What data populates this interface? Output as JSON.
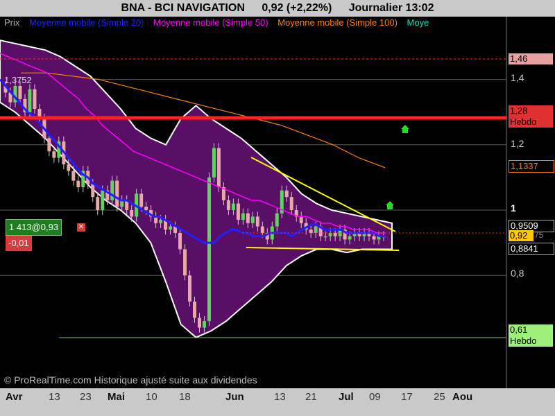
{
  "title": {
    "symbol": "BNA - BCI NAVIGATION",
    "quote": "0,92 (+2,22%)",
    "period": "Journalier  13:02"
  },
  "legend": {
    "price": "Prix",
    "ma20": "Moyenne mobile (Simple 20)",
    "ma50": "Moyenne mobile (Simple 50)",
    "ma100": "Moyenne mobile (Simple 100)",
    "ma_cut": "Moye",
    "colors": {
      "price": "#b0b0b0",
      "ma20": "#2020ff",
      "ma50": "#ff00ff",
      "ma100": "#ff8000",
      "ma_cut": "#00e0c0"
    }
  },
  "boxes": {
    "order": "1 413@0,93",
    "change": "-0,01",
    "p146": "1,46",
    "p128": "1,28",
    "p128_tag": "Hebdo",
    "p11337": "1,1337",
    "p09509": "0,9509",
    "p092": "0,92",
    "p092_suffix": "75",
    "p08841": "0,8841",
    "p061": "0,61",
    "p061_tag": "Hebdo",
    "top_label": "1,3752"
  },
  "copyright": "© ProRealTime.com Historique ajusté suite aux dividendes",
  "xaxis": {
    "labels": [
      {
        "text": "Avr",
        "month": true
      },
      {
        "text": "13",
        "month": false
      },
      {
        "text": "23",
        "month": false
      },
      {
        "text": "Mai",
        "month": true
      },
      {
        "text": "10",
        "month": false
      },
      {
        "text": "18",
        "month": false
      },
      {
        "text": "Jun",
        "month": true
      },
      {
        "text": "13",
        "month": false
      },
      {
        "text": "21",
        "month": false
      },
      {
        "text": "Jul",
        "month": true
      },
      {
        "text": "09",
        "month": false
      },
      {
        "text": "17",
        "month": false
      },
      {
        "text": "25",
        "month": false
      },
      {
        "text": "Aou",
        "month": true
      }
    ]
  },
  "chart_data": {
    "type": "line",
    "title": "BNA - BCI NAVIGATION",
    "y_ticks": [
      "1,4",
      "1,2",
      "1",
      "0,8"
    ],
    "ylim": [
      0.49,
      1.6
    ],
    "grid": true,
    "price_close": [
      1.36,
      1.33,
      1.38,
      1.34,
      1.3,
      1.37,
      1.31,
      1.28,
      1.22,
      1.18,
      1.16,
      1.21,
      1.14,
      1.12,
      1.09,
      1.07,
      1.12,
      1.08,
      1.04,
      1.0,
      1.06,
      1.03,
      1.09,
      1.01,
      1.03,
      1.0,
      0.98,
      1.05,
      1.01,
      1.0,
      0.98,
      0.96,
      0.97,
      0.94,
      0.95,
      0.93,
      0.88,
      0.8,
      0.72,
      0.67,
      0.64,
      0.66,
      1.1,
      1.19,
      1.07,
      1.03,
      1.0,
      1.02,
      0.97,
      0.99,
      0.96,
      0.98,
      0.95,
      0.93,
      0.91,
      0.95,
      0.99,
      1.06,
      1.04,
      1.0,
      0.98,
      0.96,
      0.94,
      0.93,
      0.95,
      0.92,
      0.92,
      0.93,
      0.92,
      0.94,
      0.91,
      0.92,
      0.93,
      0.92,
      0.93,
      0.92,
      0.91,
      0.92,
      0.92
    ],
    "ma20": [
      1.4,
      1.38,
      1.36,
      1.34,
      1.32,
      1.3,
      1.29,
      1.27,
      1.25,
      1.23,
      1.21,
      1.19,
      1.17,
      1.15,
      1.13,
      1.11,
      1.1,
      1.08,
      1.07,
      1.06,
      1.05,
      1.04,
      1.03,
      1.03,
      1.02,
      1.01,
      1.0,
      0.99,
      0.98,
      0.98,
      0.97,
      0.96,
      0.95,
      0.94,
      0.93,
      0.92,
      0.91,
      0.9,
      0.9,
      0.9,
      0.92,
      0.93,
      0.94,
      0.94,
      0.93,
      0.93,
      0.92,
      0.92,
      0.92,
      0.93,
      0.93,
      0.93,
      0.93,
      0.92,
      0.93,
      0.94,
      0.95,
      0.96,
      0.95,
      0.94,
      0.94,
      0.94,
      0.94,
      0.93,
      0.93,
      0.93,
      0.93,
      0.93,
      0.93,
      0.92,
      0.92
    ],
    "ma50": [
      1.48,
      1.47,
      1.46,
      1.45,
      1.44,
      1.43,
      1.42,
      1.4,
      1.38,
      1.36,
      1.34,
      1.31,
      1.29,
      1.26,
      1.24,
      1.22,
      1.2,
      1.18,
      1.17,
      1.16,
      1.15,
      1.14,
      1.13,
      1.12,
      1.11,
      1.1,
      1.09,
      1.08,
      1.07,
      1.06,
      1.05,
      1.04,
      1.03,
      1.03,
      1.02,
      1.01,
      1.0,
      0.99,
      0.98,
      0.98,
      0.97,
      0.96,
      0.96,
      0.95,
      0.95,
      0.94,
      0.94,
      0.94,
      0.93,
      0.93
    ],
    "ma100": [
      1.42,
      1.42,
      1.41,
      1.4,
      1.38,
      1.36,
      1.34,
      1.32,
      1.3,
      1.28,
      1.26,
      1.23,
      1.2,
      1.16,
      1.13
    ],
    "boll_upper": [
      1.52,
      1.51,
      1.5,
      1.49,
      1.47,
      1.44,
      1.41,
      1.36,
      1.31,
      1.25,
      1.22,
      1.2,
      1.28,
      1.32,
      1.28,
      1.25,
      1.22,
      1.18,
      1.14,
      1.1,
      1.05,
      1.02,
      1.0,
      0.99,
      0.98,
      0.97,
      0.96
    ],
    "boll_lower": [
      1.33,
      1.3,
      1.26,
      1.22,
      1.17,
      1.12,
      1.07,
      1.03,
      1.0,
      0.96,
      0.9,
      0.78,
      0.65,
      0.61,
      0.63,
      0.66,
      0.7,
      0.74,
      0.78,
      0.83,
      0.86,
      0.88,
      0.88,
      0.87,
      0.88,
      0.88,
      0.88
    ]
  }
}
